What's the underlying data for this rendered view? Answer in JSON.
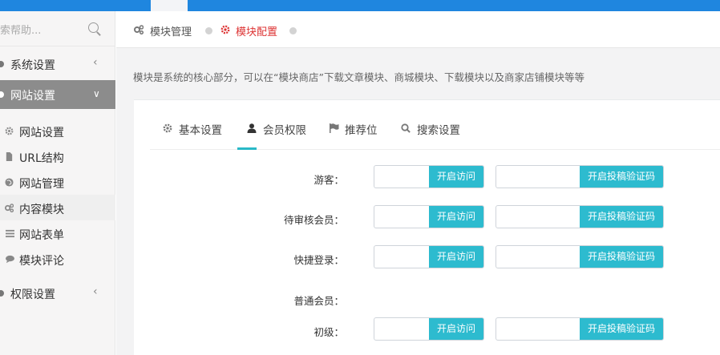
{
  "sidebar": {
    "search_placeholder": "索帮助...",
    "items": [
      {
        "label": "系统设置"
      },
      {
        "label": "网站设置"
      },
      {
        "label": "权限设置"
      }
    ],
    "subitems": [
      {
        "label": "网站设置"
      },
      {
        "label": "URL结构"
      },
      {
        "label": "网站管理"
      },
      {
        "label": "内容模块"
      },
      {
        "label": "网站表单"
      },
      {
        "label": "模块评论"
      }
    ]
  },
  "breadcrumb": {
    "item1": "模块管理",
    "item2": "模块配置"
  },
  "description": "模块是系统的核心部分，可以在“模块商店”下载文章模块、商城模块、下载模块以及商家店铺模块等等",
  "tabs": [
    {
      "label": "基本设置"
    },
    {
      "label": "会员权限"
    },
    {
      "label": "推荐位"
    },
    {
      "label": "搜索设置"
    }
  ],
  "form": {
    "rows": [
      {
        "label": "游客：",
        "btn1": "开启访问",
        "btn2": "开启投稿验证码"
      },
      {
        "label": "待审核会员：",
        "btn1": "开启访问",
        "btn2": "开启投稿验证码"
      },
      {
        "label": "快捷登录：",
        "btn1": "开启访问",
        "btn2": "开启投稿验证码"
      },
      {
        "label": "初级：",
        "btn1": "开启访问",
        "btn2": "开启投稿验证码"
      }
    ],
    "group_label": "普通会员："
  },
  "colors": {
    "topbar": "#1f86df",
    "accent": "#2dbbcf",
    "breadcrumb_active": "#dd3333"
  }
}
